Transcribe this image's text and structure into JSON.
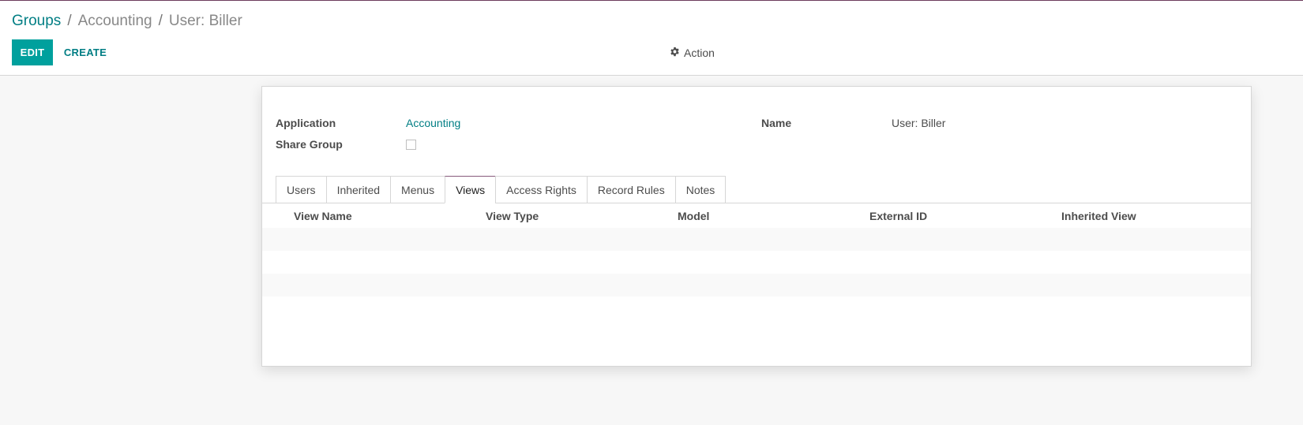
{
  "breadcrumb": {
    "root": "Groups",
    "separator": "/",
    "middle": "Accounting",
    "current": "User: Biller"
  },
  "toolbar": {
    "edit_label": "EDIT",
    "create_label": "CREATE",
    "action_label": "Action"
  },
  "form": {
    "application_label": "Application",
    "application_value": "Accounting",
    "share_group_label": "Share Group",
    "share_group_checked": false,
    "name_label": "Name",
    "name_value": "User: Biller"
  },
  "tabs": [
    {
      "label": "Users"
    },
    {
      "label": "Inherited"
    },
    {
      "label": "Menus"
    },
    {
      "label": "Views",
      "active": true
    },
    {
      "label": "Access Rights"
    },
    {
      "label": "Record Rules"
    },
    {
      "label": "Notes"
    }
  ],
  "views_table": {
    "columns": [
      "View Name",
      "View Type",
      "Model",
      "External ID",
      "Inherited View"
    ],
    "rows": []
  },
  "colors": {
    "primary": "#00a09d",
    "link": "#017e84",
    "active_tab_accent": "#875a7b"
  }
}
